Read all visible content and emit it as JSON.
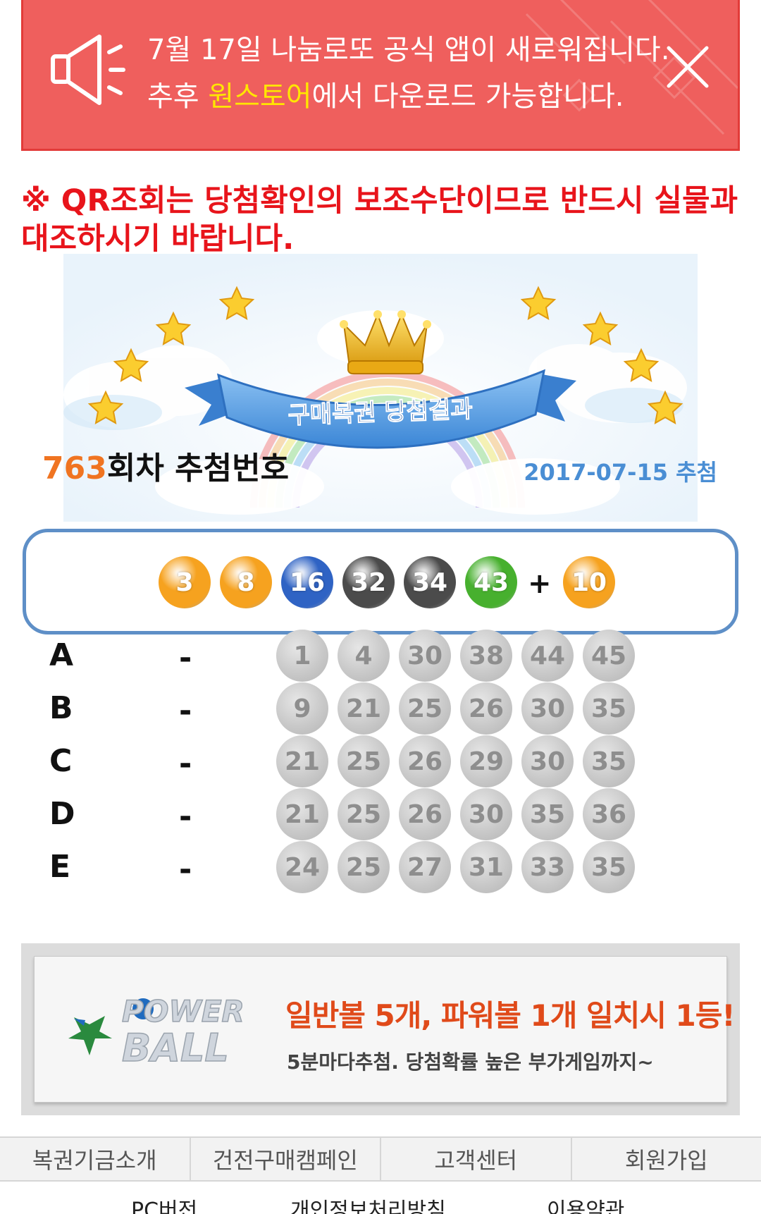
{
  "notice": {
    "line1": "7월 17일 나눔로또 공식 앱이 새로워집니다.",
    "line2_prefix": "추후 ",
    "line2_highlight": "원스토어",
    "line2_suffix": "에서 다운로드 가능합니다.",
    "background": "#ef5f5d",
    "highlight_color": "#ffe600"
  },
  "warning": "※ QR조회는 당첨확인의 보조수단이므로 반드시 실물과 대조하시기 바랍니다.",
  "hero": {
    "ribbon_text": "구매복권 당첨결과"
  },
  "result": {
    "round": "763",
    "round_suffix": "회차 추첨번호",
    "date": "2017-07-15 추첨",
    "numbers": [
      {
        "value": "3",
        "color": "#f6a21f"
      },
      {
        "value": "8",
        "color": "#f6a21f"
      },
      {
        "value": "16",
        "color": "#2f63c4"
      },
      {
        "value": "32",
        "color": "#4b4b4b"
      },
      {
        "value": "34",
        "color": "#4b4b4b"
      },
      {
        "value": "43",
        "color": "#47b02e"
      }
    ],
    "plus": "+",
    "bonus": {
      "value": "10",
      "color": "#f6a21f"
    }
  },
  "games": [
    {
      "label": "A",
      "result": "-",
      "numbers": [
        "1",
        "4",
        "30",
        "38",
        "44",
        "45"
      ]
    },
    {
      "label": "B",
      "result": "-",
      "numbers": [
        "9",
        "21",
        "25",
        "26",
        "30",
        "35"
      ]
    },
    {
      "label": "C",
      "result": "-",
      "numbers": [
        "21",
        "25",
        "26",
        "29",
        "30",
        "35"
      ]
    },
    {
      "label": "D",
      "result": "-",
      "numbers": [
        "21",
        "25",
        "26",
        "30",
        "35",
        "36"
      ]
    },
    {
      "label": "E",
      "result": "-",
      "numbers": [
        "24",
        "25",
        "27",
        "31",
        "33",
        "35"
      ]
    }
  ],
  "ad": {
    "logo_line1": "POWER",
    "logo_line2": "BALL",
    "headline": "일반볼 5개, 파워볼 1개 일치시 1등!",
    "subline": "5분마다추첨. 당첨확률 높은 부가게임까지~"
  },
  "footer_nav": [
    "복권기금소개",
    "건전구매캠페인",
    "고객센터",
    "회원가입"
  ],
  "footer_links": [
    "PC버전",
    "개인정보처리방침",
    "이용약관"
  ]
}
